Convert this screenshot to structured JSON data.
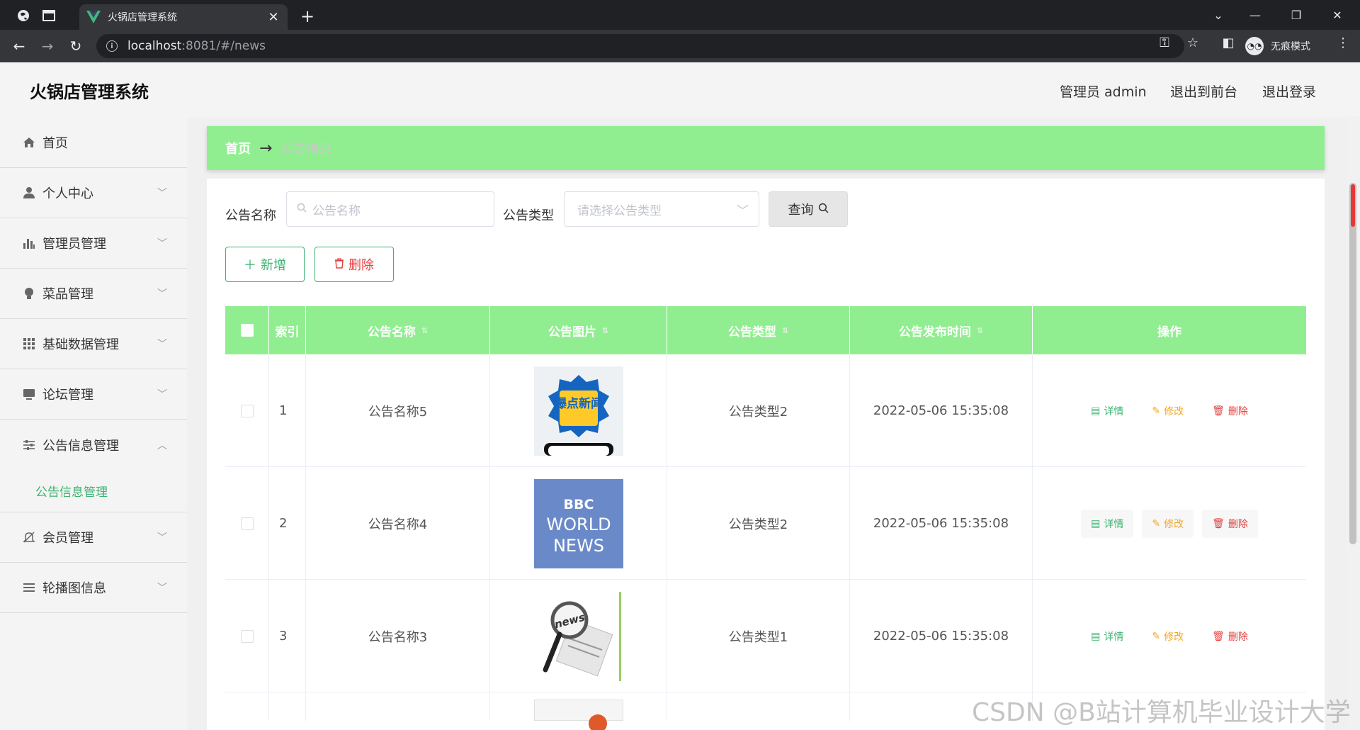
{
  "browser": {
    "tab_title": "火锅店管理系统",
    "url_host": "localhost",
    "url_rest": ":8081/#/news",
    "incognito_label": "无痕模式"
  },
  "header": {
    "title": "火锅店管理系统",
    "user": "管理员 admin",
    "to_frontend": "退出到前台",
    "logout": "退出登录"
  },
  "sidebar": {
    "items": [
      {
        "label": "首页",
        "icon": "home-icon"
      },
      {
        "label": "个人中心",
        "icon": "user-icon"
      },
      {
        "label": "管理员管理",
        "icon": "bar-chart-icon"
      },
      {
        "label": "菜品管理",
        "icon": "bulb-icon"
      },
      {
        "label": "基础数据管理",
        "icon": "grid-icon"
      },
      {
        "label": "论坛管理",
        "icon": "monitor-icon"
      },
      {
        "label": "公告信息管理",
        "icon": "sliders-icon"
      },
      {
        "label": "会员管理",
        "icon": "bell-off-icon"
      },
      {
        "label": "轮播图信息",
        "icon": "list-icon"
      }
    ],
    "submenu_active": "公告信息管理"
  },
  "breadcrumb": {
    "home": "首页",
    "arrow": "→",
    "current": "公告信息"
  },
  "search": {
    "name_label": "公告名称",
    "name_placeholder": "公告名称",
    "type_label": "公告类型",
    "type_placeholder": "请选择公告类型",
    "query_button": "查询"
  },
  "actions": {
    "add": "新增",
    "delete": "删除"
  },
  "table": {
    "columns": [
      "索引",
      "公告名称",
      "公告图片",
      "公告类型",
      "公告发布时间",
      "操作"
    ],
    "rows": [
      {
        "index": "1",
        "name": "公告名称5",
        "type": "公告类型2",
        "time": "2022-05-06 15:35:08",
        "image_text": "爆点新闻"
      },
      {
        "index": "2",
        "name": "公告名称4",
        "type": "公告类型2",
        "time": "2022-05-06 15:35:08",
        "image_text": "BBC WORLD NEWS"
      },
      {
        "index": "3",
        "name": "公告名称3",
        "type": "公告类型1",
        "time": "2022-05-06 15:35:08",
        "image_text": "news"
      }
    ],
    "ops": {
      "detail": "详情",
      "edit": "修改",
      "delete": "删除"
    }
  },
  "watermark": "CSDN @B站计算机毕业设计大学",
  "colors": {
    "accent": "#90ee90",
    "green": "#3cb371",
    "orange": "#f5a623",
    "red": "#e54040"
  }
}
